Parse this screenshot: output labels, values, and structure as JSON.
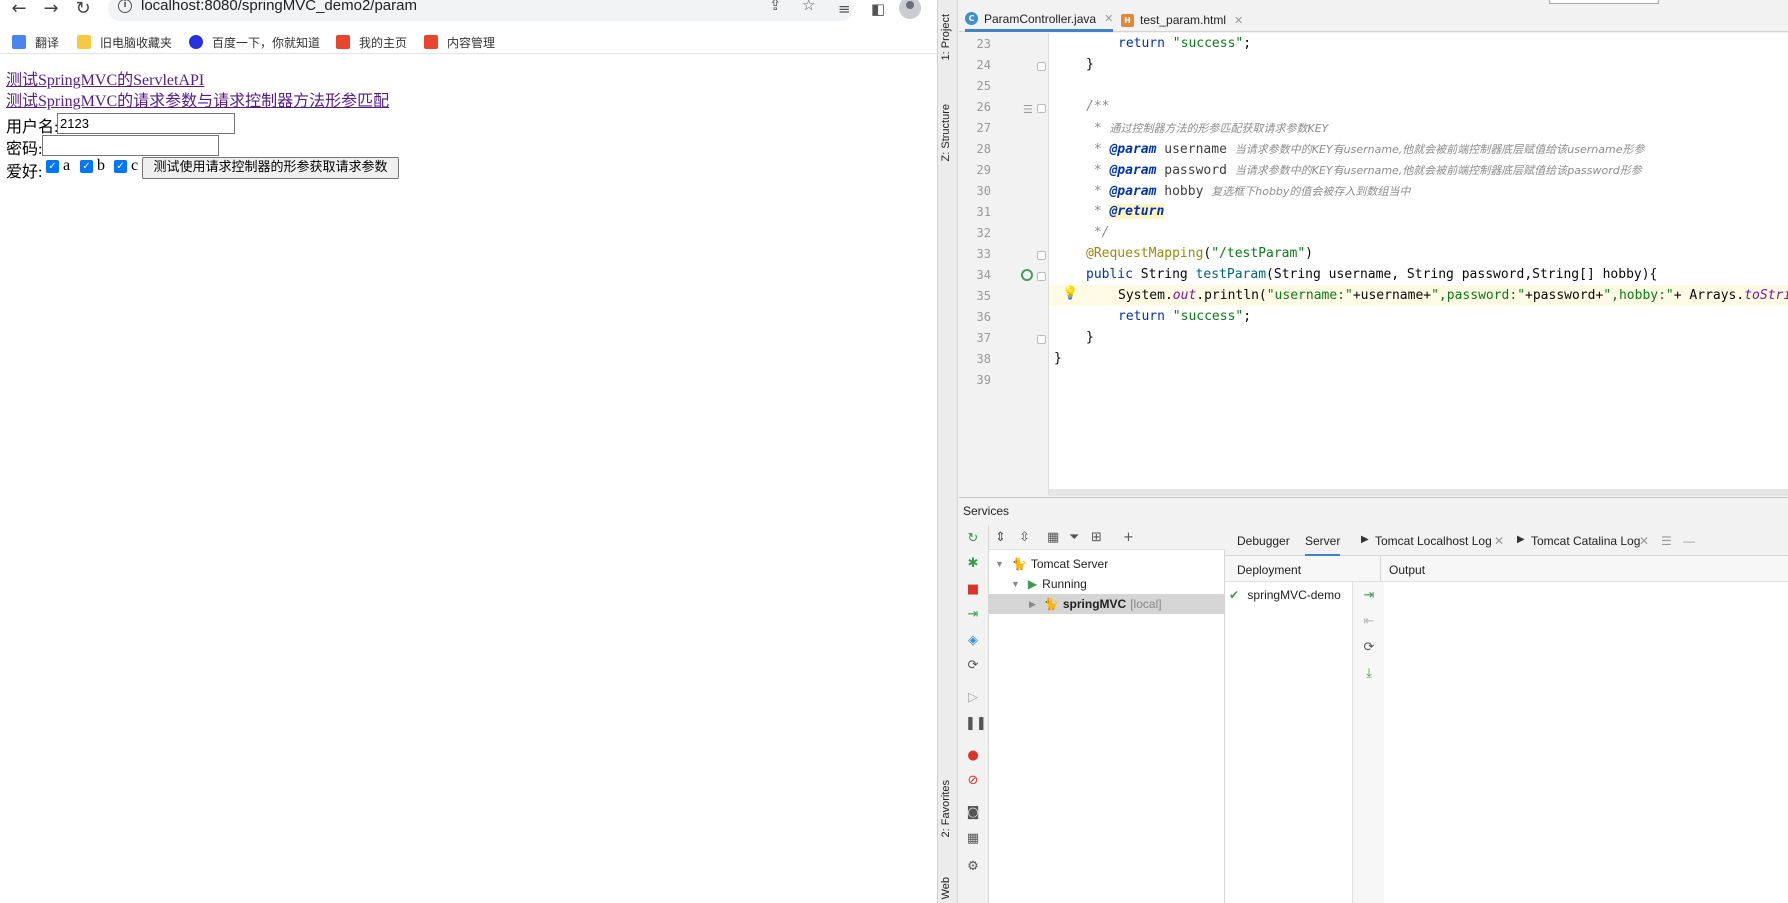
{
  "browser": {
    "url": "localhost:8080/springMVC_demo2/param",
    "bookmarks": [
      {
        "label": "翻译",
        "icon": "translate-icon",
        "color": "#4a84f0"
      },
      {
        "label": "旧电脑收藏夹",
        "icon": "folder-icon",
        "color": "#f5c945"
      },
      {
        "label": "百度一下，你就知道",
        "icon": "baidu-icon",
        "color": "#2932e1"
      },
      {
        "label": "我的主页",
        "icon": "c-logo-icon",
        "color": "#e8452c"
      },
      {
        "label": "内容管理",
        "icon": "c-logo-icon",
        "color": "#e8452c"
      }
    ],
    "page": {
      "link1": "测试SpringMVC的ServletAPI",
      "link2": "测试SpringMVC的请求参数与请求控制器方法形参匹配",
      "username_label": "用户名:",
      "username_value": "2123",
      "password_label": "密码:",
      "password_value": "",
      "hobby_label": "爱好:",
      "hobby_options": [
        "a",
        "b",
        "c"
      ],
      "hobby_checked": [
        true,
        true,
        true
      ],
      "submit_label": "测试使用请求控制器的形参获取请求参数"
    }
  },
  "ide": {
    "side_tabs": [
      "1: Project",
      "Z: Structure",
      "2: Favorites",
      "Web"
    ],
    "editor_tabs": [
      {
        "label": "ParamController.java",
        "icon": "java-class-icon",
        "active": true
      },
      {
        "label": "test_param.html",
        "icon": "html-file-icon",
        "active": false
      }
    ],
    "line_numbers": [
      "23",
      "24",
      "25",
      "26",
      "27",
      "28",
      "29",
      "30",
      "31",
      "32",
      "33",
      "34",
      "35",
      "36",
      "37",
      "38",
      "39"
    ],
    "code": {
      "l23": {
        "kw": "return ",
        "str": "\"success\"",
        "tail": ";"
      },
      "l24": "}",
      "l26": "/**",
      "l27": {
        "star": " * ",
        "text": "通过控制器方法的形参匹配获取请求参数KEY"
      },
      "l28": {
        "star": " * ",
        "tag": "@param",
        "name": " username ",
        "text": "当请求参数中的KEY有username,他就会被前端控制器底层赋值给该username形参"
      },
      "l29": {
        "star": " * ",
        "tag": "@param",
        "name": " password ",
        "text": "当请求参数中的KEY有username,他就会被前端控制器底层赋值给该password形参"
      },
      "l30": {
        "star": " * ",
        "tag": "@param",
        "name": " hobby ",
        "text": "复选框下hobby的值会被存入到数组当中"
      },
      "l31": {
        "star": " * ",
        "tag": "@return"
      },
      "l32": " */",
      "l33": {
        "ann": "@RequestMapping",
        "open": "(",
        "str": "\"/testParam\"",
        "close": ")"
      },
      "l34": {
        "kw": "public ",
        "type": "String ",
        "fn": "testParam",
        "params": "(String username, String password,String[] hobby){"
      },
      "l35": {
        "cls": "System.",
        "fld": "out",
        "dot": ".println(",
        "s1": "\"username:\"",
        "p1": "+username+",
        "s2": "\",password:\"",
        "p2": "+password+",
        "s3": "\",hobby:\"",
        "p3": "+ Arrays.",
        "fn": "toString"
      },
      "l36": {
        "kw": "return ",
        "str": "\"success\"",
        "tail": ";"
      },
      "l37": "}",
      "l38": "}"
    },
    "services": {
      "title": "Services",
      "tree": [
        {
          "label": "Tomcat Server"
        },
        {
          "label": "Running"
        },
        {
          "label": "springMVC",
          "suffix": "[local]"
        }
      ],
      "tabs": [
        "Debugger",
        "Server",
        "Tomcat Localhost Log",
        "Tomcat Catalina Log"
      ],
      "deployment_header": "Deployment",
      "output_header": "Output",
      "deployment_item": "springMVC-demo"
    }
  }
}
